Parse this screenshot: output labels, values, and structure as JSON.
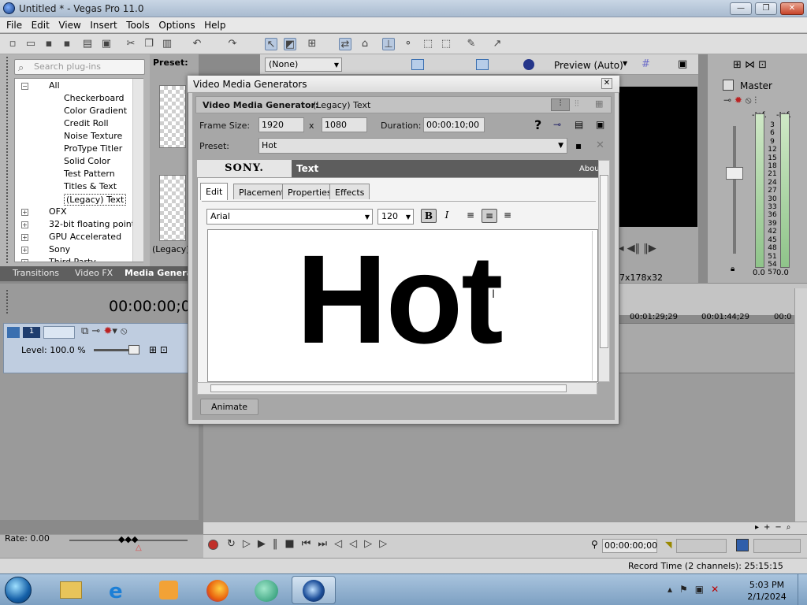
{
  "window": {
    "title": "Untitled * - Vegas Pro 11.0"
  },
  "menu": [
    "File",
    "Edit",
    "View",
    "Insert",
    "Tools",
    "Options",
    "Help"
  ],
  "explorer": {
    "search_placeholder": "Search plug-ins",
    "preset_label": "Preset:",
    "tree": [
      {
        "label": "All",
        "level": 0,
        "expander": "-"
      },
      {
        "label": "Checkerboard",
        "level": 1
      },
      {
        "label": "Color Gradient",
        "level": 1
      },
      {
        "label": "Credit Roll",
        "level": 1
      },
      {
        "label": "Noise Texture",
        "level": 1
      },
      {
        "label": "ProType Titler",
        "level": 1
      },
      {
        "label": "Solid Color",
        "level": 1
      },
      {
        "label": "Test Pattern",
        "level": 1
      },
      {
        "label": "Titles & Text",
        "level": 1
      },
      {
        "label": "(Legacy) Text",
        "level": 1,
        "selected": true
      },
      {
        "label": "OFX",
        "level": 0,
        "expander": "+"
      },
      {
        "label": "32-bit floating point",
        "level": 0,
        "expander": "+"
      },
      {
        "label": "GPU Accelerated",
        "level": 0,
        "expander": "+"
      },
      {
        "label": "Sony",
        "level": 0,
        "expander": "+"
      },
      {
        "label": "Third Party",
        "level": 0,
        "expander": "+"
      }
    ],
    "thumb_caption": "(Legacy)",
    "tabs": [
      "Transitions",
      "Video FX",
      "Media Genera"
    ]
  },
  "preview": {
    "none_select": "(None)",
    "quality": "Preview (Auto)",
    "size_readout": "7x178x32"
  },
  "master": {
    "title": "Master",
    "left_inf": "-Inf.",
    "right_inf": "-Inf.",
    "scale": [
      "3",
      "6",
      "9",
      "12",
      "15",
      "18",
      "21",
      "24",
      "27",
      "30",
      "33",
      "36",
      "39",
      "42",
      "45",
      "48",
      "51",
      "54",
      "57"
    ],
    "left_val": "0.0",
    "right_val": "0.0"
  },
  "timeline": {
    "timecode": "00:00:00;0",
    "track_number": "1",
    "level": "Level: 100.0 %",
    "ruler": [
      "00:01:29;29",
      "00:01:44;29",
      "00:0"
    ],
    "rate": "Rate: 0.00",
    "transport_time": "00:00:00;00",
    "record_time": "Record Time (2 channels): 25:15:15"
  },
  "dialog": {
    "title": "Video Media Generators",
    "generator_label": "Video Media Generator:",
    "generator_name": "(Legacy) Text",
    "frame_size_label": "Frame Size:",
    "width": "1920",
    "x": "x",
    "height": "1080",
    "duration_label": "Duration:",
    "duration": "00:00:10;00",
    "help": "?",
    "preset_label": "Preset:",
    "preset_value": "Hot",
    "sony_logo": "SONY.",
    "plugin_title": "Text",
    "about": "About",
    "tabs": [
      "Edit",
      "Placement",
      "Properties",
      "Effects"
    ],
    "font": "Arial",
    "font_size": "120",
    "bold": "B",
    "italic": "I",
    "text": "Hot",
    "animate": "Animate"
  },
  "taskbar": {
    "time": "5:03 PM",
    "date": "2/1/2024"
  },
  "colors": {
    "taskbar": "#8fb0d0",
    "dialog_bg": "#d4d4d4",
    "selected_tool": "#b8c9e0"
  }
}
